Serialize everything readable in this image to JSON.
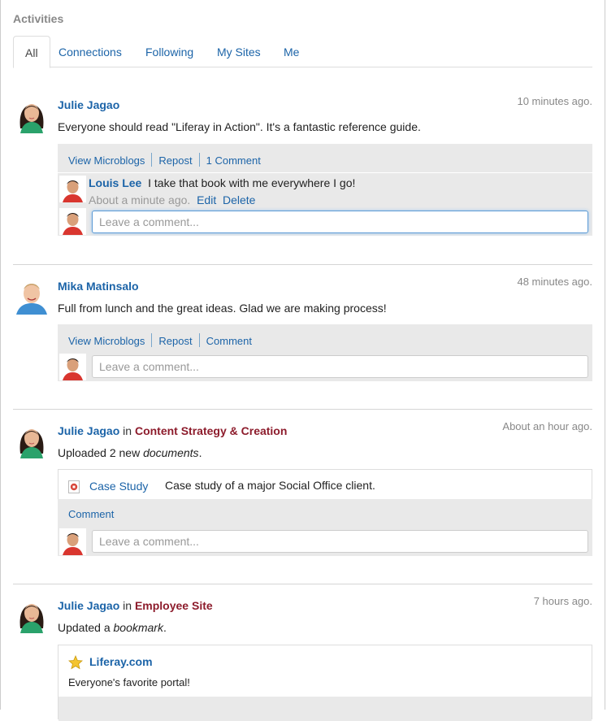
{
  "portlet": {
    "title": "Activities"
  },
  "tabs": [
    "All",
    "Connections",
    "Following",
    "My Sites",
    "Me"
  ],
  "activities": [
    {
      "author": "Julie Jagao",
      "time": "10 minutes ago.",
      "text": "Everyone should read \"Liferay in Action\". It's a fantastic reference guide.",
      "actions": [
        "View Microblogs",
        "Repost",
        "1 Comment"
      ],
      "reply": {
        "author": "Louis Lee",
        "text": "I take that book with me everywhere I go!",
        "time": "About a minute ago.",
        "edit": "Edit",
        "delete": "Delete"
      },
      "comment_placeholder": "Leave a comment..."
    },
    {
      "author": "Mika Matinsalo",
      "time": "48 minutes ago.",
      "text": "Full from lunch and the great ideas. Glad we are making process!",
      "actions": [
        "View Microblogs",
        "Repost",
        "Comment"
      ],
      "comment_placeholder": "Leave a comment..."
    },
    {
      "author": "Julie Jagao",
      "in": "in",
      "site": "Content Strategy & Creation",
      "time": "About an hour ago.",
      "text_prefix": "Uploaded 2 new ",
      "text_em": "documents",
      "text_suffix": ".",
      "document": {
        "name": "Case Study",
        "description": "Case study of a major Social Office client."
      },
      "actions": [
        "Comment"
      ],
      "comment_placeholder": "Leave a comment..."
    },
    {
      "author": "Julie Jagao",
      "in": "in",
      "site": "Employee Site",
      "time": "7 hours ago.",
      "text_prefix": "Updated a ",
      "text_em": "bookmark",
      "text_suffix": ".",
      "bookmark": {
        "title": "Liferay.com",
        "description": "Everyone's favorite portal!"
      }
    }
  ]
}
